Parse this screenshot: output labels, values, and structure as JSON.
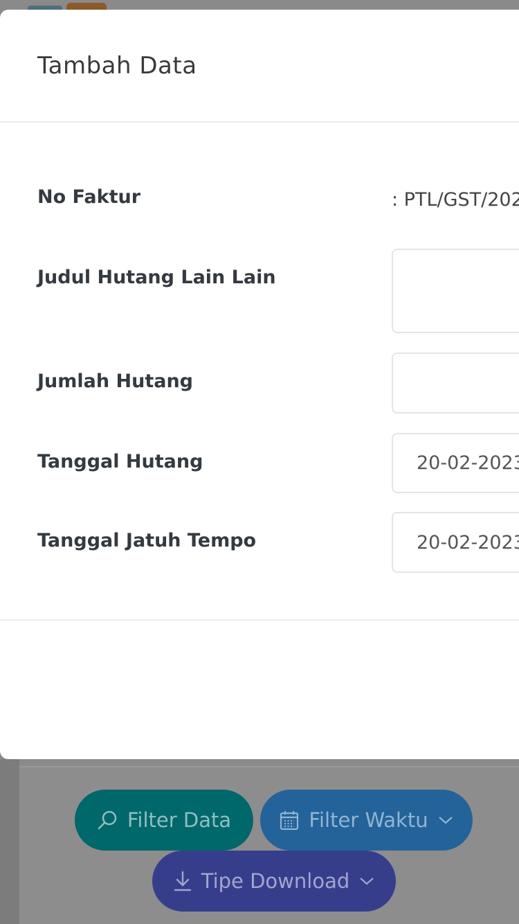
{
  "modal": {
    "title": "Tambah Data",
    "fields": {
      "no_faktur": {
        "label": "No Faktur",
        "value": ": PTL/GST/202"
      },
      "judul": {
        "label": "Judul Hutang Lain Lain",
        "value": ""
      },
      "jumlah": {
        "label": "Jumlah Hutang",
        "value": ""
      },
      "tanggal": {
        "label": "Tanggal Hutang",
        "value": "20-02-2023"
      },
      "jatuh_tempo": {
        "label": "Tanggal Jatuh Tempo",
        "value": "20-02-2023"
      }
    }
  },
  "background": {
    "filter_data_label": "Filter Data",
    "filter_waktu_label": "Filter Waktu",
    "tipe_download_label": "Tipe Download"
  },
  "icons": {
    "filter_data": "search-icon",
    "filter_waktu": "calendar-icon",
    "tipe_download": "download-icon",
    "dropdown": "chevron-down-icon"
  }
}
